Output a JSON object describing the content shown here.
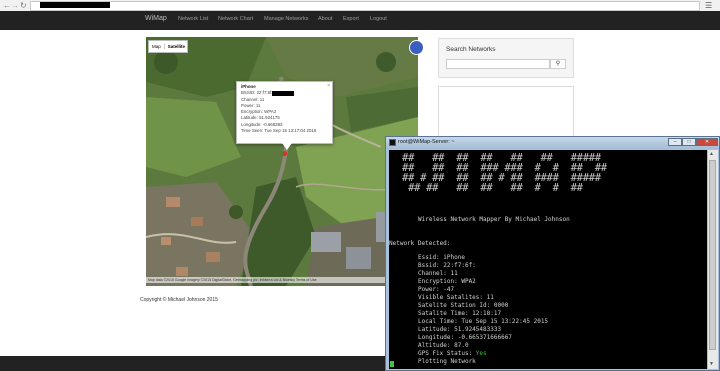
{
  "browser": {
    "back_icon": "back-arrow-icon",
    "forward_icon": "forward-arrow-icon",
    "reload_icon": "reload-icon",
    "menu_icon": "hamburger-menu-icon"
  },
  "navbar": {
    "brand": "WiMap",
    "links": [
      "Network List",
      "Network Chart",
      "Manage Networks",
      "About",
      "Export",
      "Logout"
    ]
  },
  "map": {
    "type_buttons": [
      "Map",
      "Satellite"
    ],
    "attribution": "Map data ©2015 Google Imagery ©2015 DigitalGlobe, Getmapping plc, Infoterra Ltd & Bluesky   Terms of Use",
    "info": {
      "title": "iPhone",
      "lines": [
        "BSSID: 22:f7:6f:",
        "Channel: 11",
        "Power: 11",
        "Encryption: WPA2",
        "Latitude: 51.924175",
        "Longitude: -0.668383",
        "Time Seen: Tue Sep 15 13:17:04 2015"
      ],
      "close": "×"
    }
  },
  "search": {
    "title": "Search Networks",
    "placeholder": "",
    "button_icon": "search-icon"
  },
  "footer": {
    "copyright": "Copyright © Michael Johnson 2015"
  },
  "terminal": {
    "title": "root@WiMap-Server: ~",
    "subtitle": "Wireless Network Mapper By Michael Johnson",
    "detected": "Network Detected:",
    "lines": [
      "Essid: iPhone",
      "Bssid: 22:f7:6f:",
      "Channel: 11",
      "Encryption: WPA2",
      "Power: -47",
      "Visible Satalites: 11",
      "Satelite Station Id: 0000",
      "Satalite Time: 12:18:17",
      "Local Time: Tue Sep 15 13:22:45 2015",
      "Latitude: 51.9245483333",
      "Longitude: -0.665371666667",
      "Altitude: 87.0"
    ],
    "gps_label": "GPS Fix Status: ",
    "gps_value": "Yes",
    "plotting": "Plotting Network",
    "buttons": {
      "minimize": "–",
      "maximize": "□",
      "close": "✕"
    }
  }
}
